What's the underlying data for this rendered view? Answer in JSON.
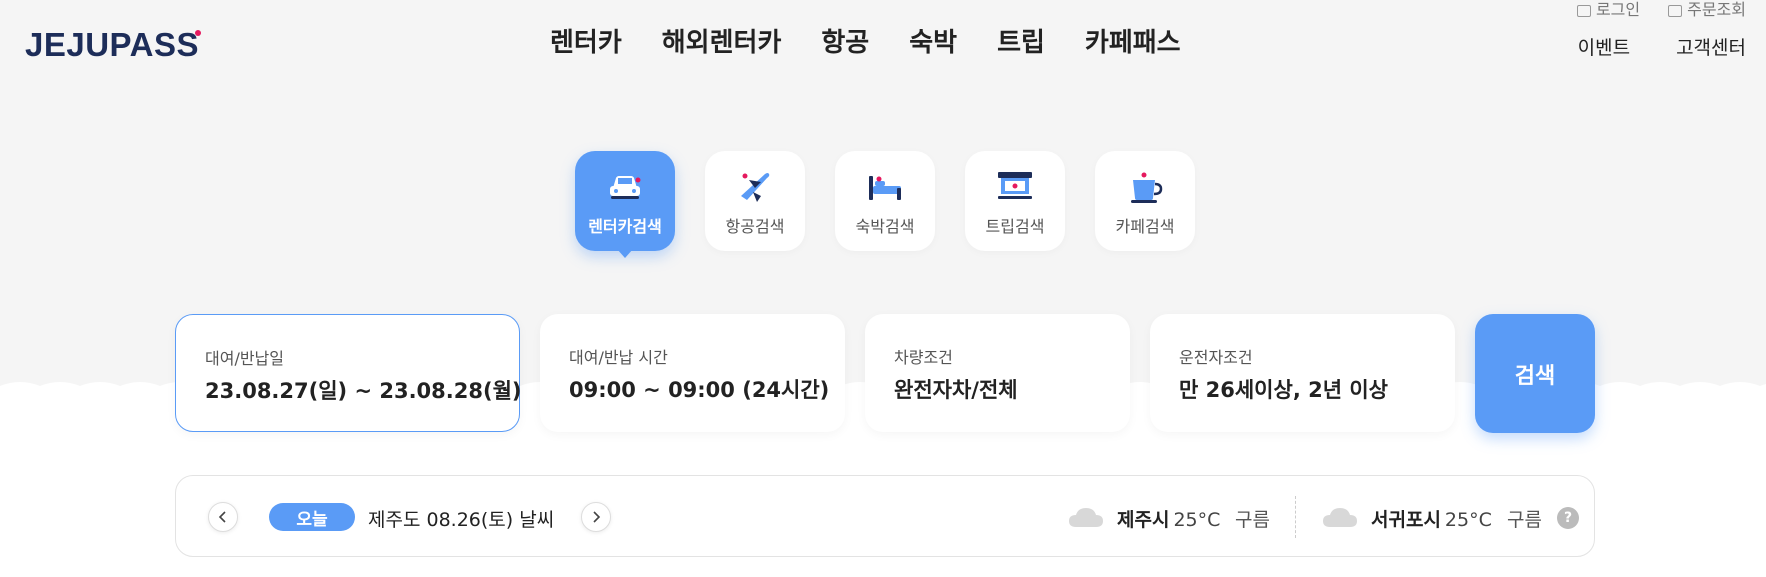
{
  "brand": {
    "logo_text": "JEJUPASS",
    "accent": "#e5195e"
  },
  "gnb": [
    "렌터카",
    "해외렌터카",
    "항공",
    "숙박",
    "트립",
    "카페패스"
  ],
  "util": {
    "login": "로그인",
    "orders": "주문조회",
    "event": "이벤트",
    "support": "고객센터"
  },
  "categories": [
    {
      "label": "렌터카검색",
      "icon": "car-icon",
      "active": true
    },
    {
      "label": "항공검색",
      "icon": "airplane-icon",
      "active": false
    },
    {
      "label": "숙박검색",
      "icon": "bed-icon",
      "active": false
    },
    {
      "label": "트립검색",
      "icon": "ticket-icon",
      "active": false
    },
    {
      "label": "카페검색",
      "icon": "cup-icon",
      "active": false
    }
  ],
  "search": {
    "dates": {
      "label": "대여/반납일",
      "value": "23.08.27(일) ~ 23.08.28(월)"
    },
    "time": {
      "label": "대여/반납 시간",
      "value": "09:00 ~ 09:00 (24시간)"
    },
    "vehicle": {
      "label": "차량조건",
      "value": "완전자차/전체"
    },
    "driver": {
      "label": "운전자조건",
      "value": "만 26세이상, 2년 이상"
    },
    "button": "검색"
  },
  "weather": {
    "today_badge": "오늘",
    "date_text": "제주도 08.26(토) 날씨",
    "cities": [
      {
        "name": "제주시",
        "temp": "25°C",
        "condition": "구름",
        "icon": "cloud-icon"
      },
      {
        "name": "서귀포시",
        "temp": "25°C",
        "condition": "구름",
        "icon": "cloud-icon"
      }
    ],
    "help": "?"
  },
  "colors": {
    "primary": "#5a9bf6",
    "navy": "#1d2d59",
    "background": "#f5f5f5"
  }
}
